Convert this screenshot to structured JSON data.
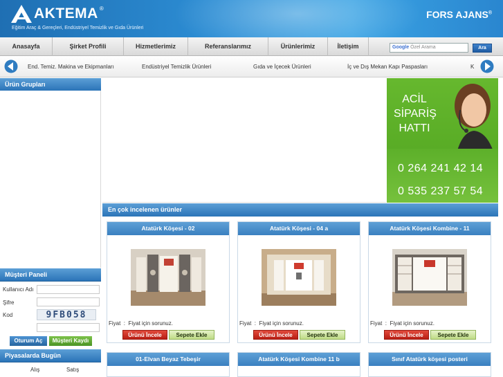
{
  "header": {
    "brand": "AKTEMA",
    "brand_reg": "®",
    "tagline": "Eğitim Araç & Gereçleri, Endüstriyel Temizlik ve Gıda Ürünleri",
    "partner": "FORS AJANS",
    "partner_reg": "®"
  },
  "nav": {
    "items": [
      {
        "label": "Anasayfa"
      },
      {
        "label": "Şirket Profili"
      },
      {
        "label": "Hizmetlerimiz"
      },
      {
        "label": "Referanslarımız"
      },
      {
        "label": "Ürünlerimiz"
      },
      {
        "label": "İletişim"
      }
    ],
    "search_google": "Google",
    "search_placeholder": "Özel Arama",
    "search_button": "Ara"
  },
  "categories": [
    "End. Temiz. Makina ve Ekipmanları",
    "Endüstriyel Temizlik Ürünleri",
    "Gıda ve İçecek Ürünleri",
    "İç ve Dış Mekan Kapı Paspasları",
    "K"
  ],
  "left": {
    "product_groups_title": "Ürün Grupları",
    "customer_panel_title": "Müşteri Paneli",
    "username_label": "Kullanıcı Adı",
    "password_label": "Şifre",
    "code_label": "Kod",
    "captcha": "9FB058",
    "login_button": "Oturum Aç",
    "register_button": "Müşteri Kaydı",
    "market_title": "Piyasalarda Bugün",
    "buy_label": "Alış",
    "sell_label": "Satış"
  },
  "promo": {
    "line1": "ACİL",
    "line2": "SİPARİŞ",
    "line3": "HATTI",
    "phone1": "0 264 241 42 14",
    "phone2": "0 535 237 57 54"
  },
  "popular": {
    "title": "En çok incelenen ürünler",
    "products": [
      {
        "name": "Atatürk Köşesi - 02",
        "price_label": "Fiyat",
        "price": "Fiyat için sorunuz.",
        "view": "Ürünü İncele",
        "cart": "Sepete Ekle"
      },
      {
        "name": "Atatürk Köşesi - 04 a",
        "price_label": "Fiyat",
        "price": "Fiyat için sorunuz.",
        "view": "Ürünü İncele",
        "cart": "Sepete Ekle"
      },
      {
        "name": "Atatürk Köşesi Kombine - 11",
        "price_label": "Fiyat",
        "price": "Fiyat için sorunuz.",
        "view": "Ürünü İncele",
        "cart": "Sepete Ekle"
      }
    ],
    "next_row": [
      {
        "name": "01-Elvan Beyaz Tebeşir"
      },
      {
        "name": "Atatürk Köşesi Kombine 11 b"
      },
      {
        "name": "Sınıf Atatürk köşesi posteri"
      }
    ]
  }
}
